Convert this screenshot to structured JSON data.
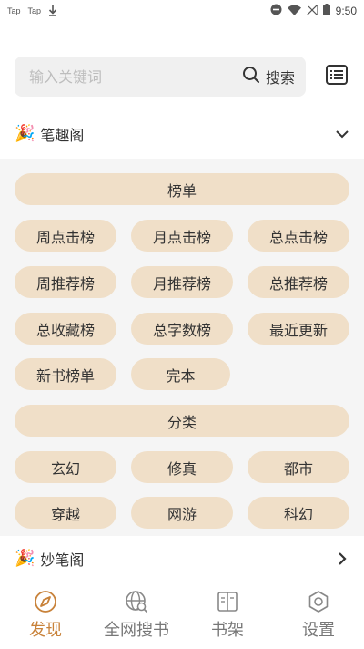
{
  "status_bar": {
    "app_notifications": [
      "Tap",
      "Tap"
    ],
    "time": "9:50"
  },
  "search": {
    "placeholder": "输入关键词",
    "value": "",
    "button_label": "搜索"
  },
  "sections": [
    {
      "title": "笔趣阁",
      "expanded": true,
      "icon": "party-popper-icon"
    },
    {
      "title": "妙笔阁",
      "expanded": false,
      "icon": "party-popper-icon"
    }
  ],
  "ranking": {
    "header": "榜单",
    "items": [
      "周点击榜",
      "月点击榜",
      "总点击榜",
      "周推荐榜",
      "月推荐榜",
      "总推荐榜",
      "总收藏榜",
      "总字数榜",
      "最近更新",
      "新书榜单",
      "完本"
    ]
  },
  "category": {
    "header": "分类",
    "items": [
      "玄幻",
      "修真",
      "都市",
      "穿越",
      "网游",
      "科幻"
    ]
  },
  "bottom_nav": [
    {
      "label": "发现",
      "icon": "compass-icon",
      "active": true
    },
    {
      "label": "全网搜书",
      "icon": "globe-search-icon",
      "active": false
    },
    {
      "label": "书架",
      "icon": "book-icon",
      "active": false
    },
    {
      "label": "设置",
      "icon": "gear-icon",
      "active": false
    }
  ],
  "colors": {
    "chip_bg": "#f0dfc8",
    "panel_bg": "#f5f5f5",
    "accent": "#c8823a",
    "search_bg": "#f0f0f0"
  }
}
